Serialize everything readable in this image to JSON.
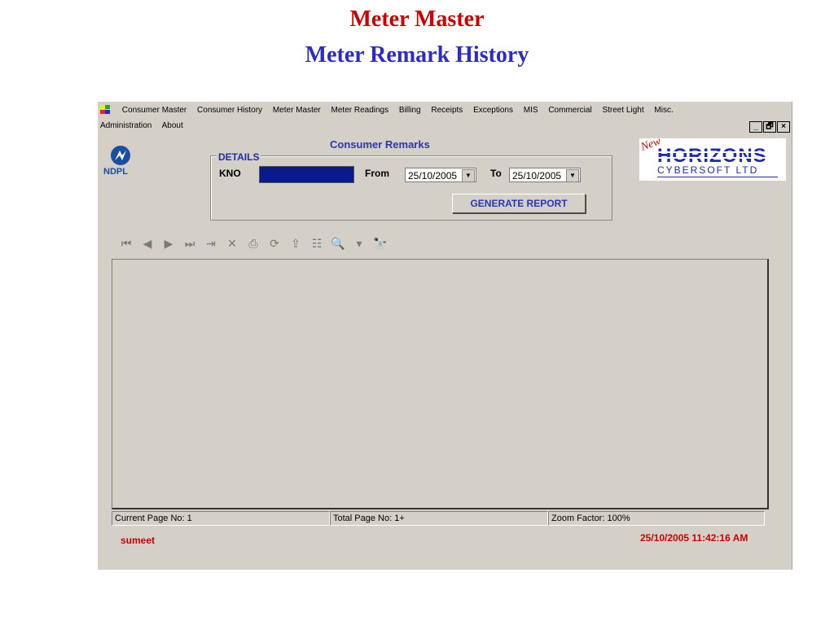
{
  "slide": {
    "title": "Meter Master",
    "subtitle": "Meter Remark History"
  },
  "menu": {
    "row1": [
      "Consumer Master",
      "Consumer History",
      "Meter Master",
      "Meter Readings",
      "Billing",
      "Receipts",
      "Exceptions",
      "MIS",
      "Commercial",
      "Street Light",
      "Misc."
    ],
    "row2": [
      "Administration",
      "About"
    ]
  },
  "window_buttons": {
    "minimize": "_",
    "restore": "🗗",
    "close": "×"
  },
  "brand": {
    "ndpl": "NDPL",
    "horizons_new": "New",
    "horizons_main": "HORIZONS",
    "horizons_sub": "CYBERSOFT LTD"
  },
  "form": {
    "title": "Consumer Remarks",
    "details_legend": "DETAILS",
    "kno_label": "KNO",
    "kno_value": "",
    "from_label": "From",
    "from_date": "25/10/2005",
    "to_label": "To",
    "to_date": "25/10/2005",
    "generate_button": "GENERATE REPORT"
  },
  "toolbar_icons": [
    "first-page-icon",
    "prev-page-icon",
    "next-page-icon",
    "last-page-icon",
    "goto-page-icon",
    "close-icon",
    "print-icon",
    "refresh-icon",
    "export-icon",
    "group-tree-icon",
    "zoom-icon",
    "dropdown-icon",
    "search-icon"
  ],
  "status": {
    "current_page": "Current Page No: 1",
    "total_page": "Total Page No: 1+",
    "zoom": "Zoom Factor: 100%"
  },
  "footer": {
    "user": "sumeet",
    "datetime": "25/10/2005 11:42:16 AM"
  },
  "colors": {
    "title_red": "#cc0000",
    "title_blue": "#2b2bcc",
    "window_bg": "#d4d0c8",
    "kno_fill": "#0a1a8a"
  }
}
